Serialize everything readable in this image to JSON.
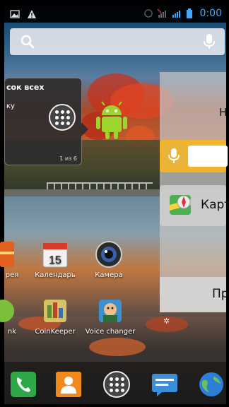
{
  "status_bar": {
    "time": "0:00",
    "left_icons": [
      "image-icon",
      "warning-icon"
    ],
    "right_icons": [
      "sync-icon",
      "no-signal-icon",
      "signal-icon",
      "battery-icon"
    ],
    "accent": "#3ea9ff"
  },
  "search_bar": {
    "icons": [
      "search-icon",
      "mic-icon"
    ]
  },
  "folder_popup": {
    "title": "сок всех",
    "subtitle": "ку",
    "pager": "1 из 6"
  },
  "right_panel": {
    "top_letter": "Н",
    "maps_label": "Карт",
    "bottom_label": "Пр"
  },
  "apps": [
    {
      "label": "рея"
    },
    {
      "label": "Календарь",
      "badge": "15"
    },
    {
      "label": "Камера"
    },
    {
      "label": "nk"
    },
    {
      "label": "CoinKeeper"
    },
    {
      "label": "Voice changer"
    }
  ],
  "dock": {
    "icons": [
      "phone-icon",
      "contacts-icon",
      "all-apps-icon",
      "messages-icon",
      "browser-icon"
    ]
  }
}
